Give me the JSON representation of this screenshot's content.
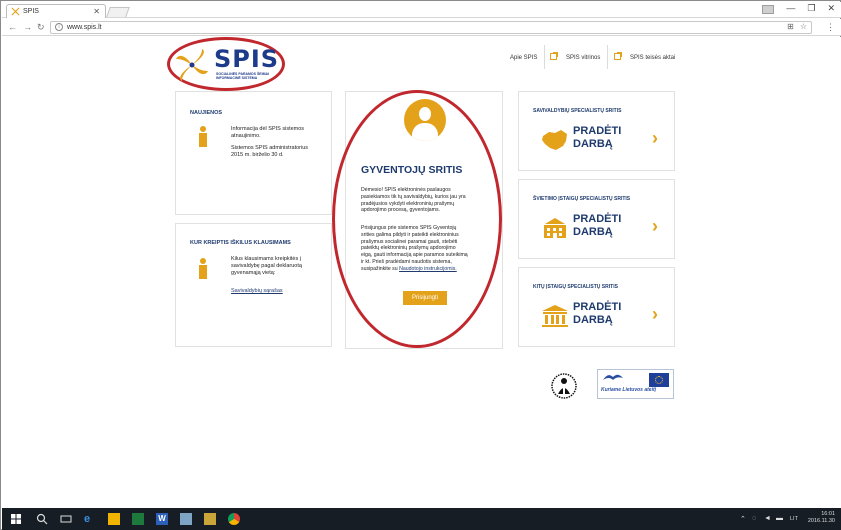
{
  "browser": {
    "tab_title": "SPIS",
    "url": "www.spis.lt"
  },
  "nav": {
    "items": [
      "Apie SPIS",
      "SPIS vitrinos",
      "SPIS teisės aktai"
    ]
  },
  "logo": {
    "text": "SPIS",
    "subtitle_line1": "SOCIALINĖS PARAMOS ŠEIMAI",
    "subtitle_line2": "INFORMACINĖ SISTEMA"
  },
  "news": {
    "title": "NAUJIENOS",
    "line1": "Informacija dėl SPIS sistemos",
    "line2": "atnaujinimo.",
    "line3": "Sistemos SPIS administratorius",
    "line4": "2015 m. birželio 30 d."
  },
  "contact": {
    "title": "KUR KREIPTIS IŠKILUS KLAUSIMAMS",
    "line1": "Kilus klausimams kreipkitės į",
    "line2": "savivaldybę pagal deklaruotą",
    "line3": "gyvenamąją vietą:",
    "link": "Savivaldybių sąrašas"
  },
  "center": {
    "title": "GYVENTOJŲ SRITIS",
    "p1_l1": "Dėmesio! SPIS elektroninės paslaugos",
    "p1_l2": "pasiekiamos tik tų savivaldybių, kurios jau yra",
    "p1_l3": "pradėjusios vykdyti elektroninių prašymų",
    "p1_l4": "apdorojimo procesą, gyventojams.",
    "p2_l1": "Prisijungus prie sistemos SPIS Gyventojų",
    "p2_l2": "srities galima pildyti ir pateikti elektroninius",
    "p2_l3": "prašymus socialinei paramai gauti, stebėti",
    "p2_l4": "pateiktų elektroninių prašymų apdorojimo",
    "p2_l5": "eigą, gauti informaciją apie paramos suteikimą",
    "p2_l6": "ir kt. Prieš pradėdami naudotis sistema,",
    "p2_l7": "susipažinkite su",
    "p2_link": "Naudotojo instrukcijomis.",
    "button": "Prisijungti"
  },
  "areas": [
    {
      "title": "SAVIVALDYBIŲ SPECIALISTŲ SRITIS",
      "start1": "PRADĖTI",
      "start2": "DARBĄ",
      "icon": "lithuania-map-icon"
    },
    {
      "title": "ŠVIETIMO ĮSTAIGŲ SPECIALISTŲ SRITIS",
      "start1": "PRADĖTI",
      "start2": "DARBĄ",
      "icon": "school-icon"
    },
    {
      "title": "KITŲ ĮSTAIGŲ SPECIALISTŲ SRITIS",
      "start1": "PRADĖTI",
      "start2": "DARBĄ",
      "icon": "institution-icon"
    }
  ],
  "footer": {
    "eu_text": "Kuriame Lietuvos ateitį"
  },
  "taskbar": {
    "lang": "LIT",
    "time": "16:01",
    "date": "2016.11.30"
  },
  "colors": {
    "accent": "#e3a21a",
    "navy": "#1f3b6e",
    "annotation_red": "#c0282d"
  }
}
